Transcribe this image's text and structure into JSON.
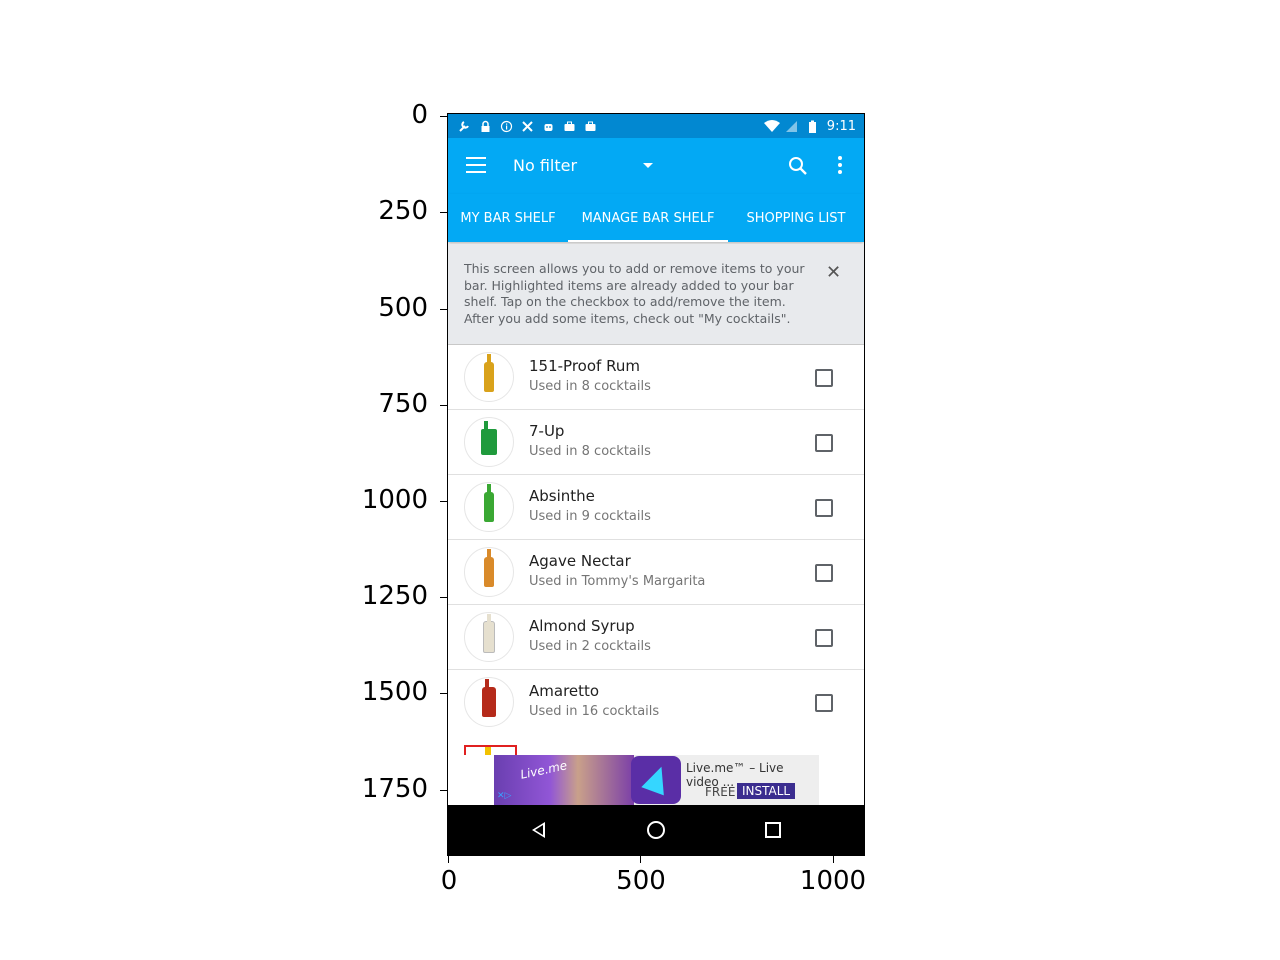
{
  "axes": {
    "y_ticks": [
      "0",
      "250",
      "500",
      "750",
      "1000",
      "1250",
      "1500",
      "1750"
    ],
    "x_ticks": [
      "0",
      "500",
      "1000"
    ]
  },
  "status_bar": {
    "time": "9:11",
    "left_icons": [
      "wrench-icon",
      "lock-icon",
      "info-icon",
      "tools-icon",
      "android-icon",
      "briefcase-icon",
      "briefcase-icon"
    ],
    "right_icons": [
      "wifi-icon",
      "signal-icon",
      "battery-icon"
    ]
  },
  "app_bar": {
    "filter_label": "No filter",
    "color": "#03a9f4"
  },
  "tabs": [
    {
      "label": "MY BAR SHELF"
    },
    {
      "label": "MANAGE BAR SHELF"
    },
    {
      "label": "SHOPPING LIST"
    }
  ],
  "info_banner": {
    "text": "This screen allows you to add or remove items to your bar. Highlighted items are already added to your bar shelf. Tap on the checkbox to add/remove the item. After you add some items, check out \"My cocktails\"."
  },
  "items": [
    {
      "name": "151-Proof Rum",
      "usage": "Used in 8 cocktails",
      "bottle_color": "#d9a21b",
      "checked": false
    },
    {
      "name": "7-Up",
      "usage": "Used in 8 cocktails",
      "bottle_color": "#1f9a3c",
      "checked": false
    },
    {
      "name": "Absinthe",
      "usage": "Used in 9 cocktails",
      "bottle_color": "#3aa833",
      "checked": false
    },
    {
      "name": "Agave Nectar",
      "usage": "Used in Tommy's Margarita",
      "bottle_color": "#d98a2a",
      "checked": false
    },
    {
      "name": "Almond Syrup",
      "usage": "Used in 2 cocktails",
      "bottle_color": "#e6e0cf",
      "checked": false
    },
    {
      "name": "Amaretto",
      "usage": "Used in 16 cocktails",
      "bottle_color": "#b52a1a",
      "checked": false
    }
  ],
  "ad": {
    "banner_text": "Live.me",
    "title": "Live.me™ – Live video ...",
    "free_label": "FREE",
    "install_label": "INSTALL"
  }
}
